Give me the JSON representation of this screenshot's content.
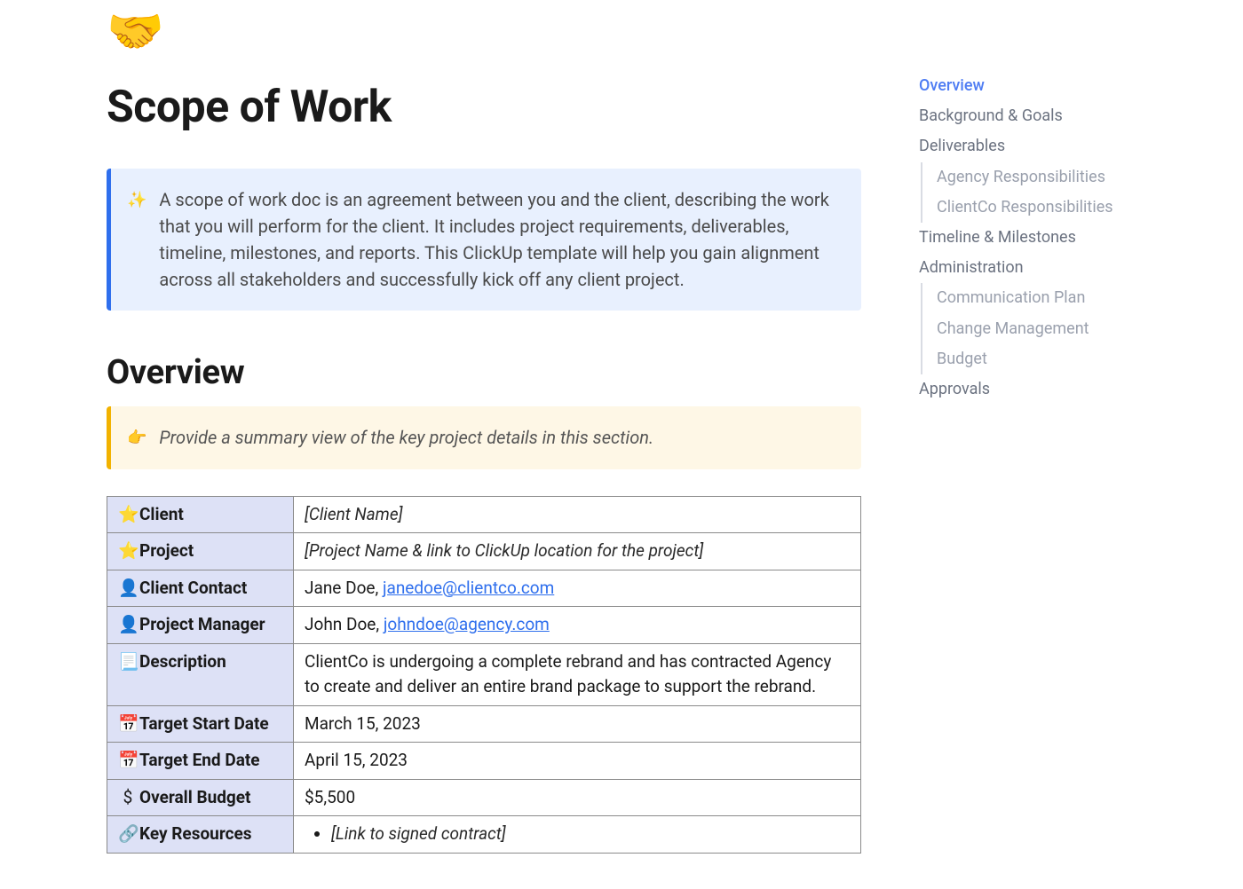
{
  "header_emoji": "🤝",
  "title": "Scope of Work",
  "intro_callout": {
    "icon": "✨",
    "text": "A scope of work doc is an agreement between you and the client, describing the work that you will perform for the client. It includes project requirements, deliverables, timeline, milestones, and reports. This ClickUp template will help you gain alignment across all stakeholders and successfully kick off any client project."
  },
  "overview": {
    "heading": "Overview",
    "hint_callout": {
      "icon": "👉",
      "text": "Provide a summary view of the key project details in this section."
    },
    "rows": {
      "client": {
        "icon": "⭐",
        "label": "Client",
        "value_italic": "[Client Name]"
      },
      "project": {
        "icon": "⭐",
        "label": "Project",
        "value_italic": "[Project Name & link to ClickUp location for the project]"
      },
      "client_contact": {
        "icon": "👤",
        "label": "Client Contact",
        "name": "Jane Doe, ",
        "email": "janedoe@clientco.com"
      },
      "project_manager": {
        "icon": "👤",
        "label": "Project Manager",
        "name": "John Doe, ",
        "email": "johndoe@agency.com"
      },
      "description": {
        "icon": "📃",
        "label": "Description",
        "value": "ClientCo is undergoing a complete rebrand and has contracted Agency to create and deliver an entire brand package to support the rebrand."
      },
      "target_start_date": {
        "icon": "📅",
        "label": "Target Start Date",
        "value": "March 15, 2023"
      },
      "target_end_date": {
        "icon": "📅",
        "label": "Target End Date",
        "value": "April 15, 2023"
      },
      "overall_budget": {
        "icon": "$",
        "label": "Overall Budget",
        "value": "$5,500"
      },
      "key_resources": {
        "icon": "🔗",
        "label": "Key Resources",
        "item1_italic": "[Link to signed contract]"
      }
    }
  },
  "outline": [
    {
      "label": "Overview",
      "active": true
    },
    {
      "label": "Background & Goals"
    },
    {
      "label": "Deliverables",
      "children": [
        {
          "label": "Agency Responsibilities"
        },
        {
          "label": "ClientCo Responsibilities"
        }
      ]
    },
    {
      "label": "Timeline & Milestones"
    },
    {
      "label": "Administration",
      "children": [
        {
          "label": "Communication Plan"
        },
        {
          "label": "Change Management"
        },
        {
          "label": "Budget"
        }
      ]
    },
    {
      "label": "Approvals"
    }
  ]
}
